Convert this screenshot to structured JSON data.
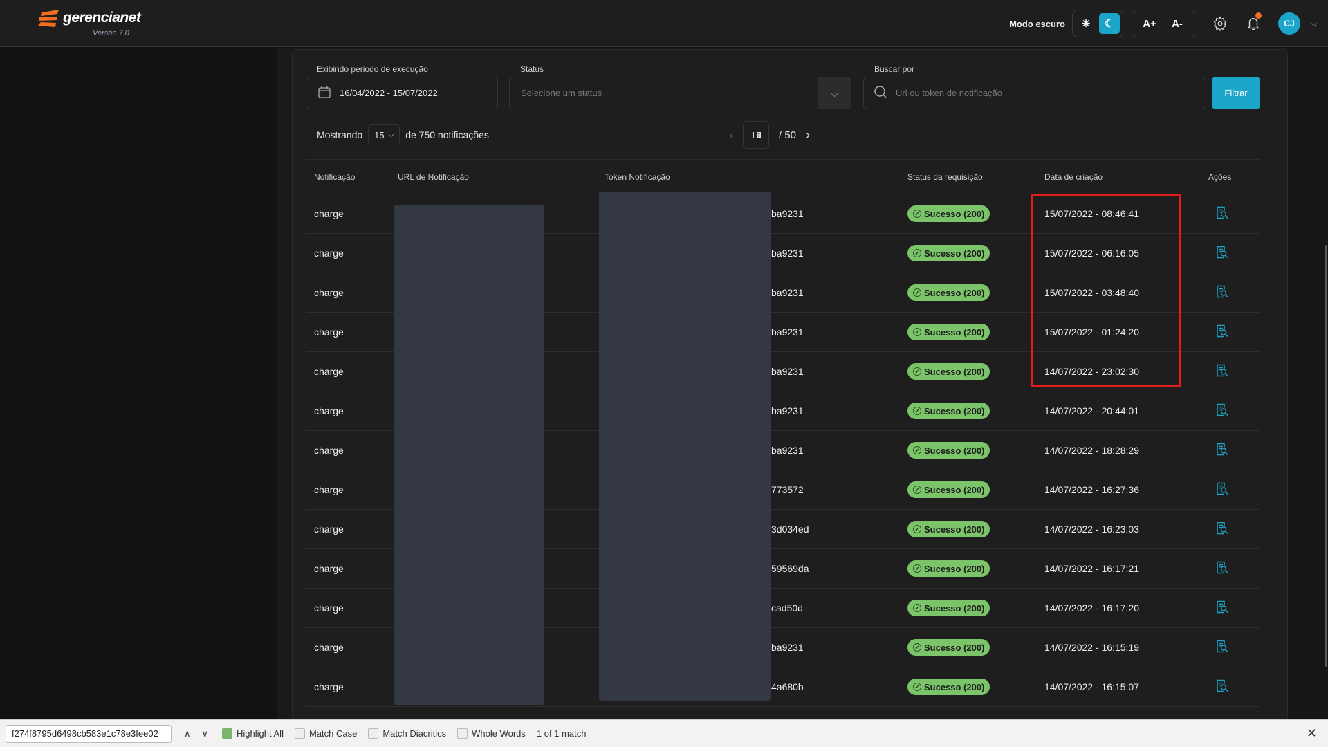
{
  "header": {
    "brand": "gerencianet",
    "version": "Versão 7.0",
    "dark_mode_label": "Modo escuro",
    "font_increase": "A+",
    "font_decrease": "A-",
    "avatar_initials": "CJ",
    "accent": "#1ba6c9",
    "notification_dot": "#f26d21"
  },
  "filters": {
    "period_label": "Exibindo periodo de execução",
    "period_value": "16/04/2022 - 15/07/2022",
    "status_label": "Status",
    "status_placeholder": "Selecione um status",
    "search_label": "Buscar por",
    "search_placeholder": "Url ou token de notificação",
    "filter_button": "Filtrar"
  },
  "listing": {
    "showing_label": "Mostrando",
    "per_page": "15",
    "total_text": "de 750 notificações",
    "current_page": "1",
    "total_pages": "/ 50"
  },
  "table": {
    "columns": [
      "Notificação",
      "URL de Notificação",
      "Token Notificação",
      "Status da requisição",
      "Data de criação",
      "Ações"
    ],
    "rows": [
      {
        "type": "charge",
        "token": "ba9231",
        "status": "Sucesso (200)",
        "date": "15/07/2022 - 08:46:41"
      },
      {
        "type": "charge",
        "token": "ba9231",
        "status": "Sucesso (200)",
        "date": "15/07/2022 - 06:16:05"
      },
      {
        "type": "charge",
        "token": "ba9231",
        "status": "Sucesso (200)",
        "date": "15/07/2022 - 03:48:40"
      },
      {
        "type": "charge",
        "token": "ba9231",
        "status": "Sucesso (200)",
        "date": "15/07/2022 - 01:24:20"
      },
      {
        "type": "charge",
        "token": "ba9231",
        "status": "Sucesso (200)",
        "date": "14/07/2022 - 23:02:30"
      },
      {
        "type": "charge",
        "token": "ba9231",
        "status": "Sucesso (200)",
        "date": "14/07/2022 - 20:44:01"
      },
      {
        "type": "charge",
        "token": "ba9231",
        "status": "Sucesso (200)",
        "date": "14/07/2022 - 18:28:29"
      },
      {
        "type": "charge",
        "token": "773572",
        "status": "Sucesso (200)",
        "date": "14/07/2022 - 16:27:36"
      },
      {
        "type": "charge",
        "token": "3d034ed",
        "status": "Sucesso (200)",
        "date": "14/07/2022 - 16:23:03"
      },
      {
        "type": "charge",
        "token": "59569da",
        "status": "Sucesso (200)",
        "date": "14/07/2022 - 16:17:21"
      },
      {
        "type": "charge",
        "token": "cad50d",
        "status": "Sucesso (200)",
        "date": "14/07/2022 - 16:17:20"
      },
      {
        "type": "charge",
        "token": "ba9231",
        "status": "Sucesso (200)",
        "date": "14/07/2022 - 16:15:19"
      },
      {
        "type": "charge",
        "token": "4a680b",
        "status": "Sucesso (200)",
        "date": "14/07/2022 - 16:15:07"
      }
    ]
  },
  "findbar": {
    "query": "f274f8795d6498cb583e1c78e3fee02",
    "highlight_all": "Highlight All",
    "match_case": "Match Case",
    "match_diacritics": "Match Diacritics",
    "whole_words": "Whole Words",
    "result": "1 of 1 match"
  }
}
